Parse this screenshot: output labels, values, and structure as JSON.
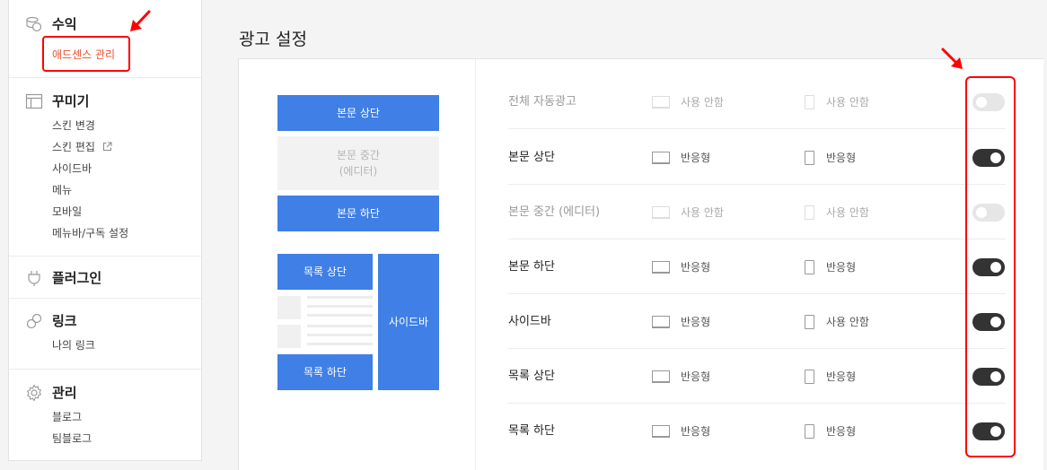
{
  "sidebar": {
    "sections": [
      {
        "title": "수익",
        "icon": "coins-icon",
        "items": [
          {
            "label": "애드센스 관리",
            "active": true
          }
        ]
      },
      {
        "title": "꾸미기",
        "icon": "layout-icon",
        "items": [
          {
            "label": "스킨 변경"
          },
          {
            "label": "스킨 편집",
            "external": true
          },
          {
            "label": "사이드바"
          },
          {
            "label": "메뉴"
          },
          {
            "label": "모바일"
          },
          {
            "label": "메뉴바/구독 설정"
          }
        ]
      },
      {
        "title": "플러그인",
        "icon": "plug-icon",
        "items": []
      },
      {
        "title": "링크",
        "icon": "link-icon",
        "items": [
          {
            "label": "나의 링크"
          }
        ]
      },
      {
        "title": "관리",
        "icon": "gear-icon",
        "items": [
          {
            "label": "블로그"
          },
          {
            "label": "팀블로그"
          }
        ]
      }
    ]
  },
  "main": {
    "title": "광고 설정",
    "preview": {
      "top": "본문 상단",
      "middle_line1": "본문 중간",
      "middle_line2": "(에디터)",
      "bottom": "본문 하단",
      "list_top": "목록 상단",
      "list_bottom": "목록 하단",
      "sidebar": "사이드바"
    },
    "rows": [
      {
        "label": "전체 자동광고",
        "desktop": "사용 안함",
        "mobile": "사용 안함",
        "enabled": false
      },
      {
        "label": "본문 상단",
        "desktop": "반응형",
        "mobile": "반응형",
        "enabled": true
      },
      {
        "label": "본문 중간 (에디터)",
        "desktop": "사용 안함",
        "mobile": "사용 안함",
        "enabled": false
      },
      {
        "label": "본문 하단",
        "desktop": "반응형",
        "mobile": "반응형",
        "enabled": true
      },
      {
        "label": "사이드바",
        "desktop": "반응형",
        "mobile": "사용 안함",
        "enabled": true
      },
      {
        "label": "목록 상단",
        "desktop": "반응형",
        "mobile": "반응형",
        "enabled": true
      },
      {
        "label": "목록 하단",
        "desktop": "반응형",
        "mobile": "반응형",
        "enabled": true
      }
    ]
  },
  "colors": {
    "accent": "#3f7fe6",
    "active_text": "#e8502d",
    "annotation": "#ff0000",
    "toggle_on": "#333333"
  }
}
